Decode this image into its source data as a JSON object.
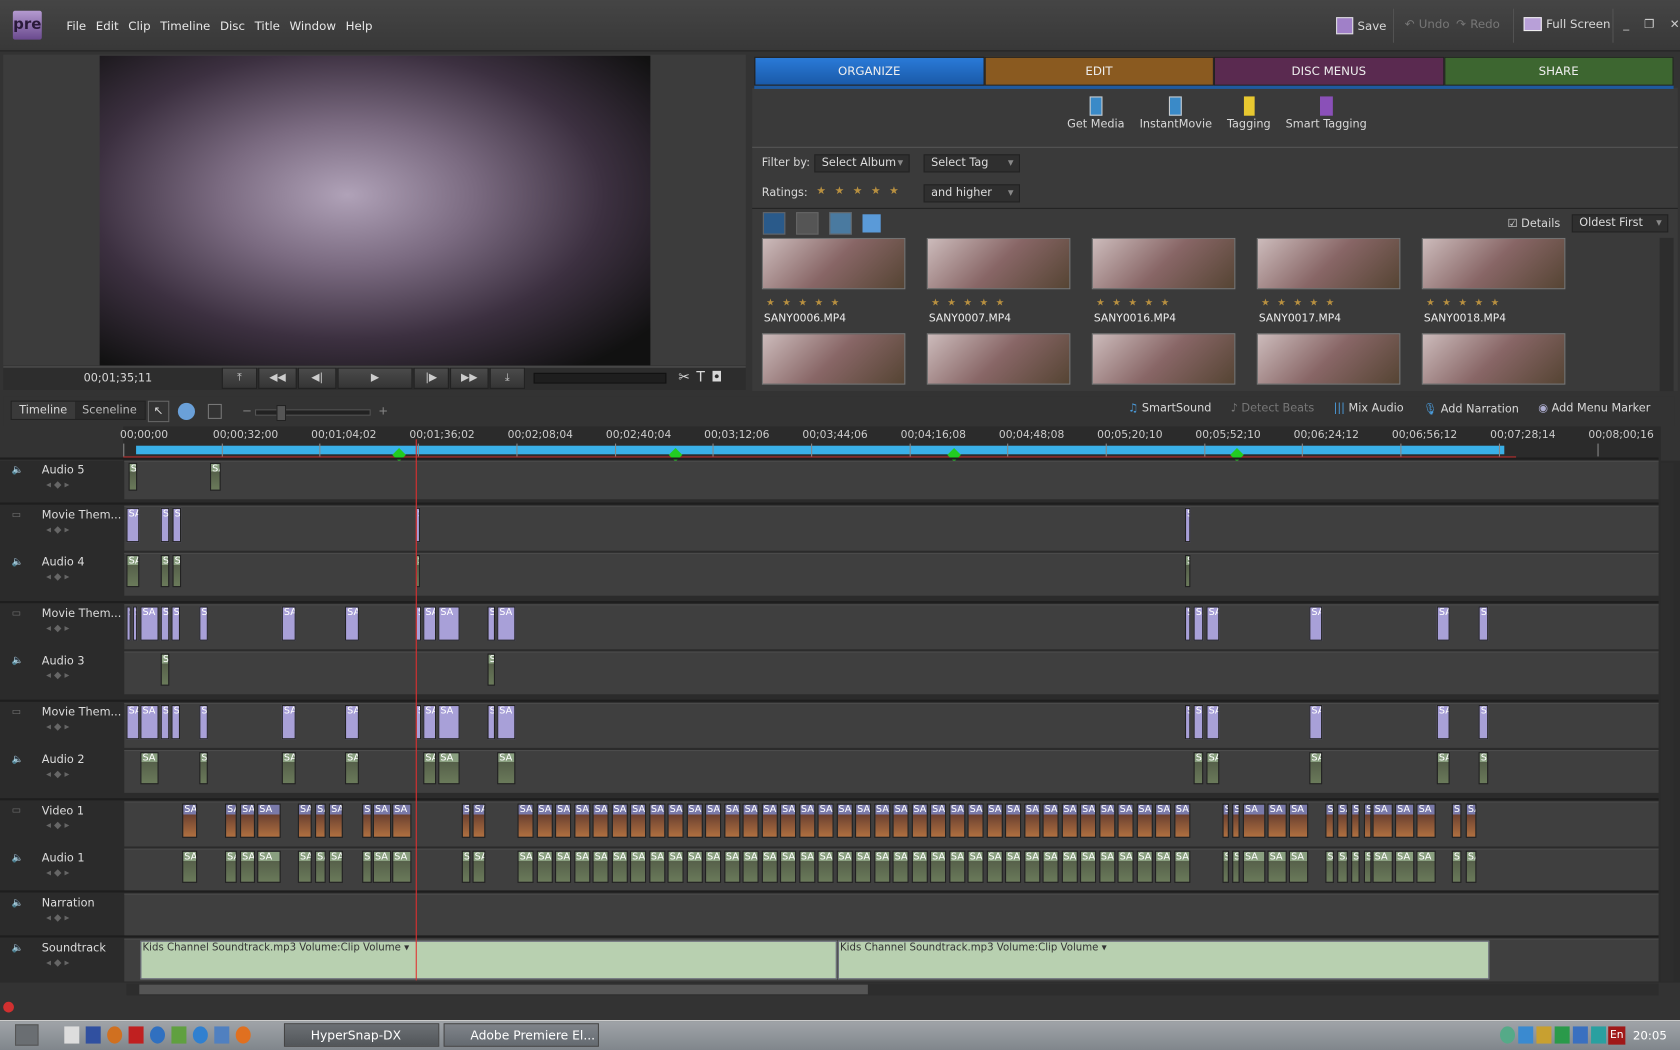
{
  "app": {
    "logo": "pre",
    "menu": [
      "File",
      "Edit",
      "Clip",
      "Timeline",
      "Disc",
      "Title",
      "Window",
      "Help"
    ],
    "save": "Save",
    "undo": "Undo",
    "redo": "Redo",
    "full_screen": "Full Screen"
  },
  "monitor": {
    "timecode": "00;01;35;11"
  },
  "tabs": [
    {
      "label": "ORGANIZE",
      "color": "#1f6cc4"
    },
    {
      "label": "EDIT",
      "color": "#8a5a20"
    },
    {
      "label": "DISC MENUS",
      "color": "#5a2a50"
    },
    {
      "label": "SHARE",
      "color": "#3d6630"
    }
  ],
  "organize": {
    "tools": [
      "Get Media",
      "InstantMovie",
      "Tagging",
      "Smart Tagging"
    ],
    "filter_label": "Filter by:",
    "album": "Select Album",
    "tag": "Select Tag",
    "ratings_label": "Ratings:",
    "ratings_mode": "and higher",
    "details": "Details",
    "details_checked": true,
    "sort": "Oldest First",
    "media": [
      "SANY0006.MP4",
      "SANY0007.MP4",
      "SANY0016.MP4",
      "SANY0017.MP4",
      "SANY0018.MP4"
    ]
  },
  "timeline": {
    "tab_timeline": "Timeline",
    "tab_sceneline": "Sceneline",
    "tools": [
      "SmartSound",
      "Detect Beats",
      "Mix Audio",
      "Add Narration",
      "Add Menu Marker"
    ],
    "ruler": [
      "00;00;00",
      "00;00;32;00",
      "00;01;04;02",
      "00;01;36;02",
      "00;02;08;04",
      "00;02;40;04",
      "00;03;12;06",
      "00;03;44;06",
      "00;04;16;08",
      "00;04;48;08",
      "00;05;20;10",
      "00;05;52;10",
      "00;06;24;12",
      "00;06;56;12",
      "00;07;28;14",
      "00;08;00;16"
    ],
    "tracks": [
      "Audio 5",
      "Movie Them...",
      "Audio 4",
      "Movie Them...",
      "Audio 3",
      "Movie Them...",
      "Audio 2",
      "Video 1",
      "Audio 1",
      "Narration",
      "Soundtrack"
    ],
    "soundtrack_clip": "Kids Channel Soundtrack.mp3  Volume:Clip Volume ▾",
    "clip_label": "SA"
  },
  "taskbar": {
    "items": [
      "HyperSnap-DX",
      "Adobe Premiere El..."
    ],
    "lang": "En",
    "clock": "20:05"
  }
}
